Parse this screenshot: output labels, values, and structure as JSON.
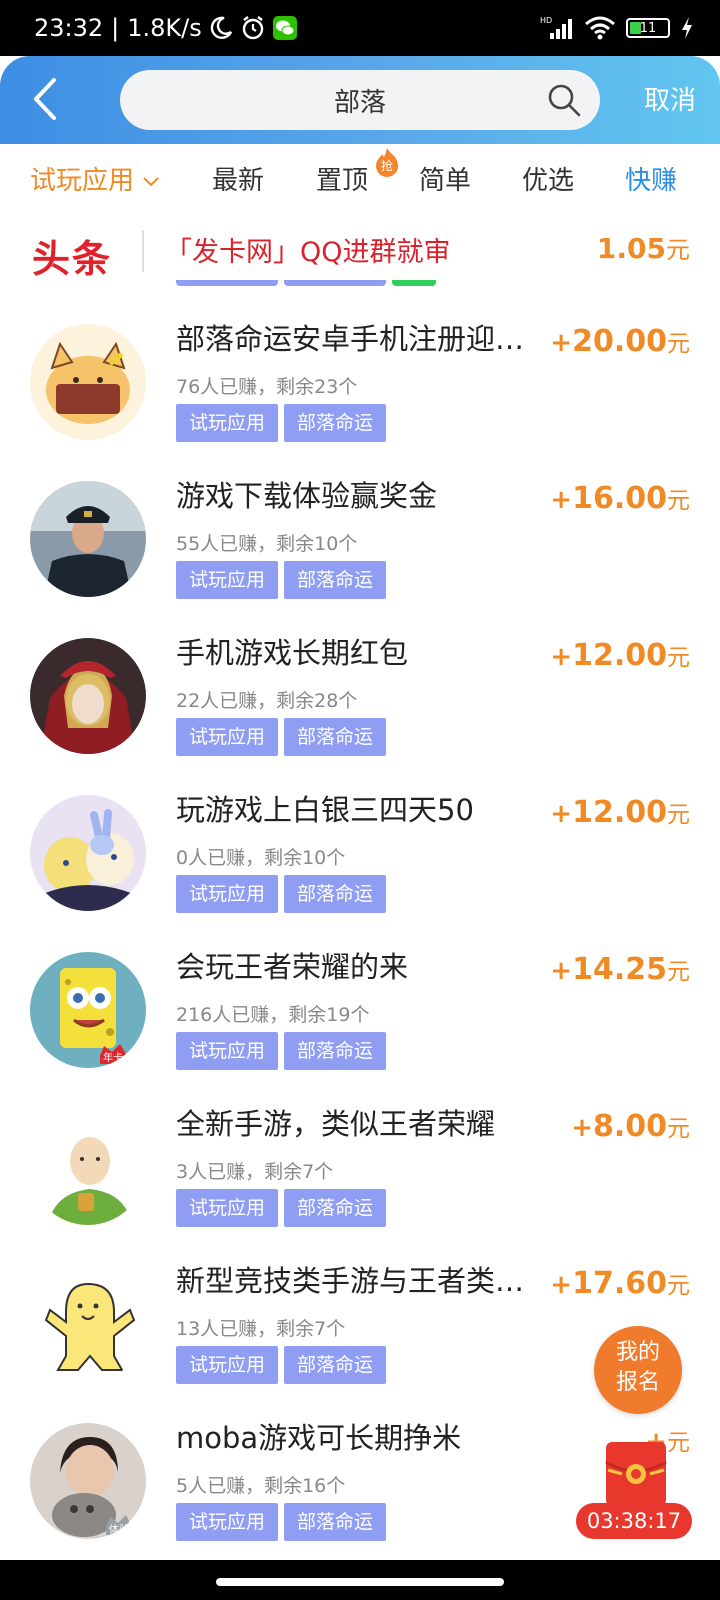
{
  "status_bar": {
    "time": "23:32",
    "separator": "|",
    "net_speed": "1.8K/s",
    "battery": "11",
    "icons": [
      "moon-icon",
      "alarm-icon",
      "wechat-icon",
      "hd-signal-icon",
      "wifi-icon",
      "battery-icon",
      "charging-icon"
    ]
  },
  "header": {
    "search_value": "部落",
    "cancel_label": "取消"
  },
  "tabs": [
    {
      "label": "试玩应用",
      "active": true
    },
    {
      "label": "最新"
    },
    {
      "label": "置顶"
    },
    {
      "label": "简单"
    },
    {
      "label": "优选"
    },
    {
      "label": "快赚"
    }
  ],
  "hot_badge": "抢",
  "headline": {
    "logo": "头条",
    "text": "「发卡网」QQ进群就审",
    "price": "1.05",
    "unit": "元"
  },
  "items": [
    {
      "title": "部落命运安卓手机注册迎…",
      "count": "76人已赚，剩余23个",
      "price": "20.00",
      "tags": [
        "试玩应用",
        "部落命运"
      ]
    },
    {
      "title": "游戏下载体验赢奖金",
      "count": "55人已赚，剩余10个",
      "price": "16.00",
      "tags": [
        "试玩应用",
        "部落命运"
      ]
    },
    {
      "title": "手机游戏长期红包",
      "count": "22人已赚，剩余28个",
      "price": "12.00",
      "tags": [
        "试玩应用",
        "部落命运"
      ]
    },
    {
      "title": "玩游戏上白银三四天50",
      "count": "0人已赚，剩余10个",
      "price": "12.00",
      "tags": [
        "试玩应用",
        "部落命运"
      ]
    },
    {
      "title": "会玩王者荣耀的来",
      "count": "216人已赚，剩余19个",
      "price": "14.25",
      "tags": [
        "试玩应用",
        "部落命运"
      ]
    },
    {
      "title": "全新手游，类似王者荣耀",
      "count": "3人已赚，剩余7个",
      "price": "8.00",
      "tags": [
        "试玩应用",
        "部落命运"
      ]
    },
    {
      "title": "新型竞技类手游与王者类…",
      "count": "13人已赚，剩余7个",
      "price": "17.60",
      "tags": [
        "试玩应用",
        "部落命运"
      ]
    },
    {
      "title": "moba游戏可长期挣米",
      "count": "5人已赚，剩余16个",
      "price": "",
      "tags": [
        "试玩应用",
        "部落命运"
      ]
    }
  ],
  "price_prefix": "+",
  "price_unit": "元",
  "avatar_badges": {
    "item4": "年卡",
    "item7": "体验"
  },
  "fab": {
    "line1": "我的",
    "line2": "报名"
  },
  "timer": "03:38:17",
  "colors": {
    "accent_orange": "#f08a24",
    "header_blue": "#3d8ee4",
    "tag_purple": "#8f9df3",
    "headline_red": "#d9232c"
  }
}
